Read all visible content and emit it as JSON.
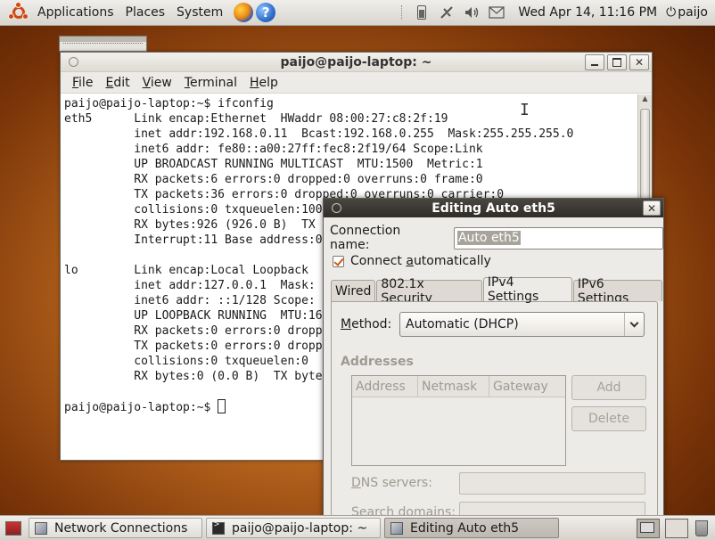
{
  "top_panel": {
    "menus": [
      "Applications",
      "Places",
      "System"
    ],
    "clock": "Wed Apr 14, 11:16 PM",
    "user": "paijo",
    "help_glyph": "?",
    "icons": [
      "ubuntu-logo",
      "firefox-icon",
      "help-icon",
      "battery-icon",
      "network-icon",
      "volume-icon",
      "mail-icon",
      "power-icon"
    ]
  },
  "terminal": {
    "title": "paijo@paijo-laptop: ~",
    "menu": [
      {
        "u": "F",
        "rest": "ile"
      },
      {
        "u": "E",
        "rest": "dit"
      },
      {
        "u": "V",
        "rest": "iew"
      },
      {
        "u": "T",
        "rest": "erminal"
      },
      {
        "u": "H",
        "rest": "elp"
      }
    ],
    "lines": [
      "paijo@paijo-laptop:~$ ifconfig",
      "eth5      Link encap:Ethernet  HWaddr 08:00:27:c8:2f:19",
      "          inet addr:192.168.0.11  Bcast:192.168.0.255  Mask:255.255.255.0",
      "          inet6 addr: fe80::a00:27ff:fec8:2f19/64 Scope:Link",
      "          UP BROADCAST RUNNING MULTICAST  MTU:1500  Metric:1",
      "          RX packets:6 errors:0 dropped:0 overruns:0 frame:0",
      "          TX packets:36 errors:0 dropped:0 overruns:0 carrier:0",
      "          collisions:0 txqueuelen:100",
      "          RX bytes:926 (926.0 B)  TX",
      "          Interrupt:11 Base address:0",
      "",
      "lo        Link encap:Local Loopback",
      "          inet addr:127.0.0.1  Mask:",
      "          inet6 addr: ::1/128 Scope:",
      "          UP LOOPBACK RUNNING  MTU:16",
      "          RX packets:0 errors:0 dropp",
      "          TX packets:0 errors:0 dropp",
      "          collisions:0 txqueuelen:0",
      "          RX bytes:0 (0.0 B)  TX byte",
      "",
      "paijo@paijo-laptop:~$ "
    ]
  },
  "dialog": {
    "title": "Editing Auto eth5",
    "connection_name_label": "Connection name:",
    "connection_name_value": "Auto eth5",
    "connect_auto_pre": "Connect ",
    "connect_auto_u": "a",
    "connect_auto_post": "utomatically",
    "connect_auto_checked": true,
    "tabs": [
      "Wired",
      "802.1x Security",
      "IPv4 Settings",
      "IPv6 Settings"
    ],
    "active_tab": 2,
    "method_label_u": "M",
    "method_label_rest": "ethod:",
    "method_value": "Automatic (DHCP)",
    "addresses_label": "Addresses",
    "address_columns": [
      "Address",
      "Netmask",
      "Gateway"
    ],
    "add_label": "Add",
    "delete_label": "Delete",
    "dns_label_u": "D",
    "dns_label_rest": "NS servers:",
    "search_domains_label": "Search domains:"
  },
  "bottom_panel": {
    "tasks": [
      "Network Connections",
      "paijo@paijo-laptop: ~",
      "Editing Auto eth5"
    ],
    "active_task": 2
  }
}
